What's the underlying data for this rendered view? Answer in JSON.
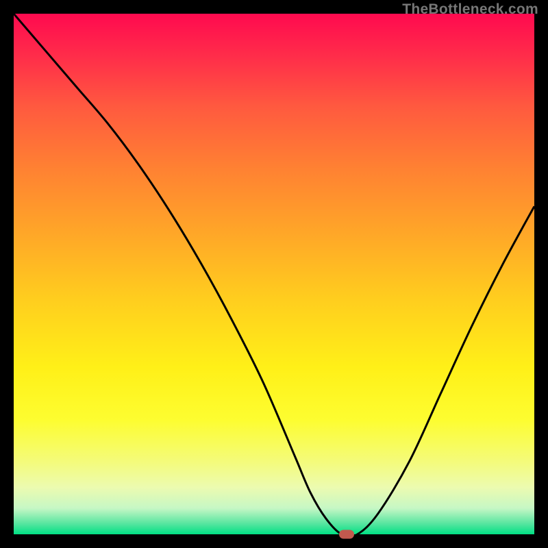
{
  "watermark": "TheBottleneck.com",
  "chart_data": {
    "type": "line",
    "title": "",
    "xlabel": "",
    "ylabel": "",
    "xlim": [
      0,
      100
    ],
    "ylim": [
      0,
      100
    ],
    "x": [
      0,
      6,
      12,
      18,
      24,
      30,
      36,
      42,
      48,
      54,
      57,
      60,
      63,
      66,
      70,
      76,
      82,
      88,
      94,
      100
    ],
    "values": [
      100,
      93,
      86,
      79,
      71,
      62,
      52,
      41,
      29,
      15,
      8,
      3,
      0,
      0,
      4,
      14,
      27,
      40,
      52,
      63
    ],
    "marker": {
      "x": 64,
      "y": 0
    },
    "background_gradient": {
      "stops": [
        {
          "pos": 0,
          "color": "#ff0a4f"
        },
        {
          "pos": 18,
          "color": "#ff5a3f"
        },
        {
          "pos": 42,
          "color": "#ffa628"
        },
        {
          "pos": 68,
          "color": "#fff018"
        },
        {
          "pos": 91,
          "color": "#ecfbb0"
        },
        {
          "pos": 100,
          "color": "#00e084"
        }
      ]
    }
  }
}
